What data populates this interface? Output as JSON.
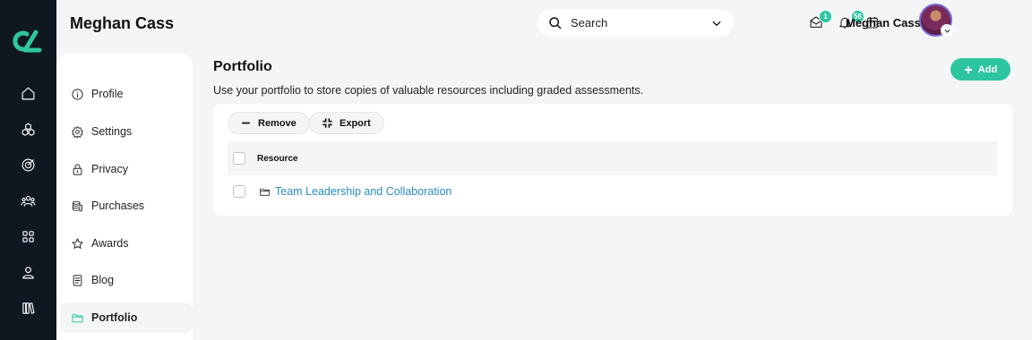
{
  "app": {
    "brand_color": "#2ec6a0",
    "rail_color": "#0f1720"
  },
  "header": {
    "title": "Meghan Cass",
    "search": {
      "placeholder": "Search"
    },
    "messages_badge": "1",
    "notifications_badge": "56",
    "user_name": "Meghan Cass"
  },
  "rail_icons": [
    "home-icon",
    "modules-icon",
    "target-icon",
    "people-icon",
    "grid-icon",
    "user-icon",
    "library-icon"
  ],
  "sidebar": {
    "items": [
      {
        "label": "Profile",
        "icon": "info-icon"
      },
      {
        "label": "Settings",
        "icon": "gear-icon"
      },
      {
        "label": "Privacy",
        "icon": "lock-icon"
      },
      {
        "label": "Purchases",
        "icon": "coins-icon"
      },
      {
        "label": "Awards",
        "icon": "star-icon"
      },
      {
        "label": "Blog",
        "icon": "document-icon"
      },
      {
        "label": "Portfolio",
        "icon": "folder-icon",
        "active": true
      }
    ]
  },
  "main": {
    "title": "Portfolio",
    "description": "Use your portfolio to store copies of valuable resources including graded assessments.",
    "add_label": "Add",
    "toolbar": {
      "remove_label": "Remove",
      "export_label": "Export"
    },
    "table": {
      "header": "Resource",
      "rows": [
        {
          "name": "Team Leadership and Collaboration"
        }
      ]
    }
  }
}
